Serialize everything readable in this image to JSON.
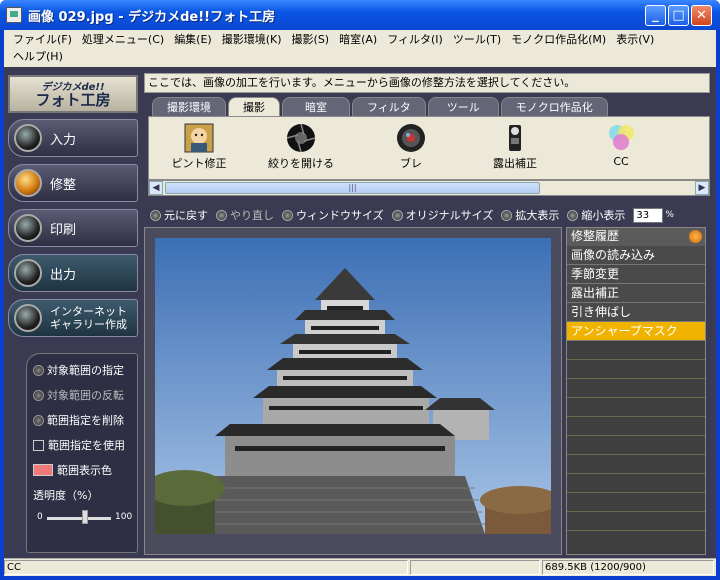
{
  "window": {
    "title": "画像 029.jpg - デジカメde!!フォト工房",
    "min_glyph": "_",
    "max_glyph": "□",
    "close_glyph": "✕"
  },
  "menu": {
    "row1": [
      "ファイル(F)",
      "処理メニュー(C)",
      "編集(E)",
      "撮影環境(K)",
      "撮影(S)",
      "暗室(A)",
      "フィルタ(I)",
      "ツール(T)",
      "モノクロ作品化(M)",
      "表示(V)"
    ],
    "row2": [
      "ヘルプ(H)"
    ]
  },
  "logo": {
    "line1": "デジカメde!!",
    "line2": "フォト工房"
  },
  "nav": {
    "input": "入力",
    "retouch": "修整",
    "print": "印刷",
    "output": "出力",
    "gallery_l1": "インターネット",
    "gallery_l2": "ギャラリー作成"
  },
  "selection": {
    "specify": "対象範囲の指定",
    "invert": "対象範囲の反転",
    "delete": "範囲指定を削除",
    "use": "範囲指定を使用",
    "color": "範囲表示色",
    "opacity_label": "透明度（%）",
    "opacity_min": "0",
    "opacity_max": "100",
    "opacity_value": 0.6
  },
  "info": {
    "message": "ここでは、画像の加工を行います。メニューから画像の修整方法を選択してください。"
  },
  "tabs": [
    "撮影環境",
    "撮影",
    "暗室",
    "フィルタ",
    "ツール",
    "モノクロ作品化"
  ],
  "active_tab": 1,
  "tools": {
    "focus": "ピント修正",
    "aperture": "絞りを開ける",
    "blur": "ブレ",
    "exposure": "露出補正",
    "cc": "CC"
  },
  "scroll_grip": "|||",
  "view": {
    "undo": "元に戻す",
    "redo": "やり直し",
    "window_size": "ウィンドウサイズ",
    "original_size": "オリジナルサイズ",
    "zoom_in": "拡大表示",
    "zoom_out": "縮小表示",
    "zoom_value": "33",
    "zoom_unit": "%"
  },
  "history": {
    "title": "修整履歴",
    "items": [
      "画像の読み込み",
      "季節変更",
      "露出補正",
      "引き伸ばし",
      "アンシャープマスク"
    ],
    "selected": 4
  },
  "status": {
    "left": "CC",
    "size": "689.5KB (1200/900)"
  }
}
